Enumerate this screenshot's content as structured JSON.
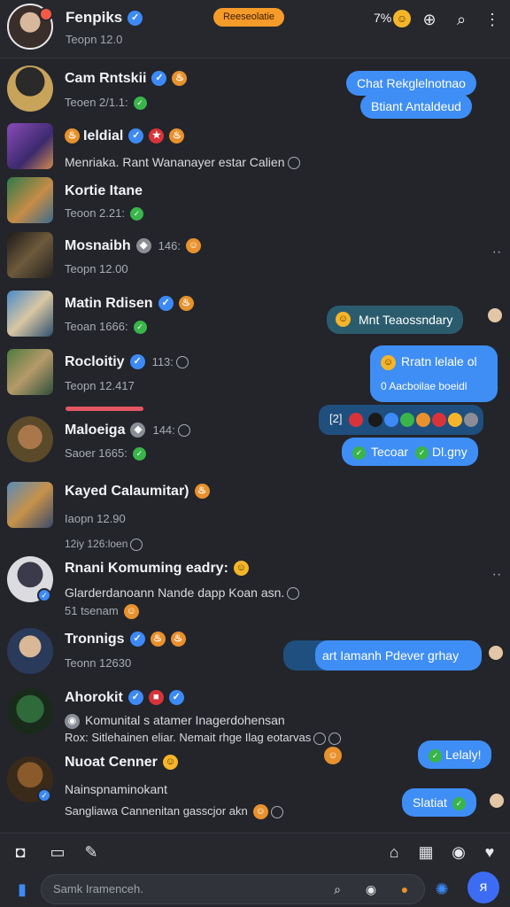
{
  "header": {
    "title": "Fenpiks",
    "subtitle": "Teopn 12.0",
    "pill": "Reeseolatie",
    "count": "7%",
    "icons": [
      "smile-emoji-icon",
      "search-plus-icon",
      "search-icon",
      "more-vertical-icon"
    ]
  },
  "chats": [
    {
      "name": "Cam Rntskii",
      "sub": "Teoen 2/1.1:",
      "badges": [
        "verified",
        "fire"
      ]
    },
    {
      "name": "Ieldial",
      "preview": "Menriaka. Rant Wananayer estar Calien",
      "badges": [
        "verified",
        "star",
        "fire"
      ]
    },
    {
      "name": "Kortie Itane",
      "sub": "Teoon 2.21:"
    },
    {
      "name": "Mosnaibh",
      "meta": "146:",
      "sub": "Teopn 12.00"
    },
    {
      "name": "Matin Rdisen",
      "sub": "Teoan 1666:"
    },
    {
      "name": "Rocloitiy",
      "meta": "113:",
      "sub": "Teopn 12.417"
    },
    {
      "name": "Maloeiga",
      "meta": "144:",
      "sub": "Saoer 1665:"
    },
    {
      "name": "Kayed Calaumitar)",
      "sub": "Iaopn 12.90",
      "subline": "12iy   126:loen"
    },
    {
      "name": "Rnani Komuming eadry:",
      "preview": "Glarderdanoann Nande dapp Koan asn.",
      "sub": "51 tsenam"
    },
    {
      "name": "Tronnigs",
      "sub": "Teonn 12630"
    },
    {
      "name": "Ahorokit",
      "preview": "Komunital s atamer Inagerdohensan",
      "preview2": "Rox:  Sitlehainen eliar. Nemait rhge Ilag eotarvas"
    },
    {
      "name": "Nuoat Cenner",
      "preview": "Nainspnaminokant",
      "preview2": "Sangliawa Cannenitan gasscjor akn"
    }
  ],
  "bubbles": {
    "b1a": "Chat Rekglelnotnao",
    "b1b": "Btiant Antaldeud",
    "b2": "Mnt Teaossndary",
    "b3a": "Rratn lelale ol",
    "b3b": "0 Aacboilae boeidl",
    "b4a": "[2]",
    "b4b": "Tecoar",
    "b4c": "Dl.gny",
    "b5": "art Iamanh Pdever grhay",
    "b6": "Lelaly!",
    "b7": "Slatiat"
  },
  "compose": {
    "placeholder": "Samk Iramenceh."
  },
  "colors": {
    "accent": "#3f8ef5",
    "pill": "#f59b2a",
    "badge": "#3d8af7",
    "bg": "#23252b"
  }
}
